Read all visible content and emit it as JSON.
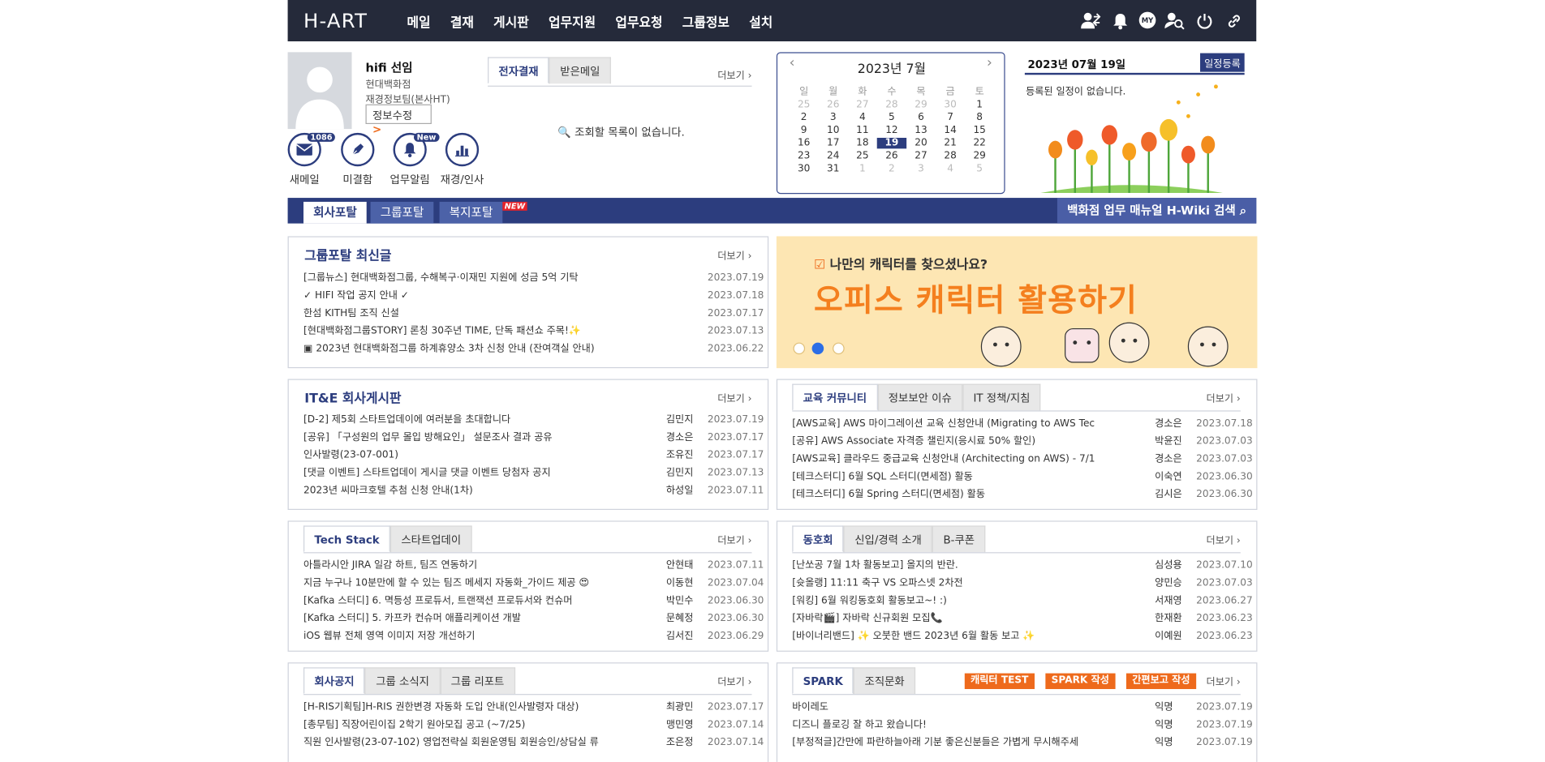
{
  "gnb": {
    "logo": "H-ART",
    "menu": [
      "메일",
      "결재",
      "게시판",
      "업무지원",
      "업무요청",
      "그룹정보",
      "설치"
    ]
  },
  "user": {
    "name": "hifi 선임",
    "company": "현대백화점",
    "dept": "재경정보팀(본사HT)",
    "edit": "정보수정",
    "edit_arrow": ">"
  },
  "quick": [
    {
      "label": "새메일",
      "icon": "mail-icon",
      "badge": "1086"
    },
    {
      "label": "미결함",
      "icon": "pen-icon",
      "badge": ""
    },
    {
      "label": "업무알림",
      "icon": "bell-icon",
      "badge": "New"
    },
    {
      "label": "재경/인사",
      "icon": "chart-icon",
      "badge": ""
    }
  ],
  "approval": {
    "tabs": [
      "전자결재",
      "받은메일"
    ],
    "more": "더보기",
    "empty": "조회할 목록이 없습니다."
  },
  "calendar": {
    "title": "2023년 7월",
    "weekdays": [
      "일",
      "월",
      "화",
      "수",
      "목",
      "금",
      "토"
    ],
    "days": [
      "25",
      "26",
      "27",
      "28",
      "29",
      "30",
      "1",
      "2",
      "3",
      "4",
      "5",
      "6",
      "7",
      "8",
      "9",
      "10",
      "11",
      "12",
      "13",
      "14",
      "15",
      "16",
      "17",
      "18",
      "19",
      "20",
      "21",
      "22",
      "23",
      "24",
      "25",
      "26",
      "27",
      "28",
      "29",
      "30",
      "31",
      "1",
      "2",
      "3",
      "4",
      "5"
    ],
    "today": "19"
  },
  "schedule": {
    "date": "2023년 07월 19일",
    "register": "일정등록",
    "empty": "등록된 일정이 없습니다."
  },
  "portal": {
    "tabs": [
      "회사포탈",
      "그룹포탈",
      "복지포탈"
    ],
    "new": "NEW",
    "search": "백화점 업무 매뉴얼 H-Wiki 검색"
  },
  "group_news": {
    "title": "그룹포탈 최신글",
    "more": "더보기",
    "rows": [
      {
        "s": "[그룹뉴스] 현대백화점그룹, 수해복구·이재민 지원에 성금 5억 기탁",
        "d": "2023.07.19"
      },
      {
        "s": "✓ HIFI 작업 공지 안내 ✓",
        "d": "2023.07.18"
      },
      {
        "s": "한섬 KITH팀 조직 신설",
        "d": "2023.07.17"
      },
      {
        "s": "[현대백화점그룹STORY] 론칭 30주년 TIME, 단독 패션쇼 주목!✨",
        "d": "2023.07.13"
      },
      {
        "s": "▣ 2023년 현대백화점그룹 하계휴양소 3차 신청 안내 (잔여객실 안내)",
        "d": "2023.06.22"
      }
    ]
  },
  "banner": {
    "headline": "나만의 캐릭터를 찾으셨나요?",
    "title": "오피스 캐릭터 활용하기"
  },
  "ite_board": {
    "title": "IT&E 회사게시판",
    "more": "더보기",
    "rows": [
      {
        "s": "[D-2] 제5회 스타트업데이에 여러분을 초대합니다",
        "a": "김민지",
        "d": "2023.07.19"
      },
      {
        "s": "[공유] 「구성원의 업무 몰입 방해요인」 설문조사 결과 공유",
        "a": "경소은",
        "d": "2023.07.17"
      },
      {
        "s": "인사발령(23-07-001)",
        "a": "조유진",
        "d": "2023.07.17"
      },
      {
        "s": "[댓글 이벤트] 스타트업데이 게시글 댓글 이벤트 당첨자 공지",
        "a": "김민지",
        "d": "2023.07.13"
      },
      {
        "s": "2023년 씨마크호텔 추첨 신청 안내(1차)",
        "a": "하성일",
        "d": "2023.07.11"
      }
    ]
  },
  "edu": {
    "tabs": [
      "교육 커뮤니티",
      "정보보안 이슈",
      "IT 정책/지침"
    ],
    "more": "더보기",
    "rows": [
      {
        "s": "[AWS교육] AWS 마이그레이션 교육 신청안내 (Migrating to AWS Tec",
        "a": "경소은",
        "d": "2023.07.18"
      },
      {
        "s": "[공유] AWS Associate 자격증 챌린지(응시료 50% 할인)",
        "a": "박윤진",
        "d": "2023.07.03"
      },
      {
        "s": "[AWS교육] 클라우드 중급교육 신청안내 (Architecting on AWS) - 7/1",
        "a": "경소은",
        "d": "2023.07.03"
      },
      {
        "s": "[테크스터디] 6월 SQL 스터디(면세점) 활동",
        "a": "이숙연",
        "d": "2023.06.30"
      },
      {
        "s": "[테크스터디] 6월 Spring 스터디(면세점) 활동",
        "a": "김시은",
        "d": "2023.06.30"
      }
    ]
  },
  "tech": {
    "tabs": [
      "Tech Stack",
      "스타트업데이"
    ],
    "more": "더보기",
    "rows": [
      {
        "s": "아틀라시안 JIRA 일감 하트, 팀즈 연동하기",
        "a": "안현태",
        "d": "2023.07.11"
      },
      {
        "s": "지금 누구나 10분만에 할 수 있는 팀즈 메세지 자동화_가이드 제공 😍",
        "a": "이동현",
        "d": "2023.07.04"
      },
      {
        "s": "[Kafka 스터디] 6. 멱등성 프로듀서, 트랜잭션 프로듀서와 컨슈머",
        "a": "박민수",
        "d": "2023.06.30"
      },
      {
        "s": "[Kafka 스터디] 5. 카프카 컨슈머 애플리케이션 개발",
        "a": "문혜정",
        "d": "2023.06.30"
      },
      {
        "s": "iOS 웹뷰 전체 영역 이미지 저장 개선하기",
        "a": "김서진",
        "d": "2023.06.29"
      }
    ]
  },
  "club": {
    "tabs": [
      "동호회",
      "신입/경력 소개",
      "B-쿠폰"
    ],
    "more": "더보기",
    "rows": [
      {
        "s": "[난쏘공 7월 1차 활동보고] 올지의 반란.",
        "a": "심성용",
        "d": "2023.07.10"
      },
      {
        "s": "[슛올랭] 11:11 축구 VS 오파스넷 2차전",
        "a": "양민승",
        "d": "2023.07.03"
      },
      {
        "s": "[워킹] 6월 워킹동호회 활동보고~! :)",
        "a": "서재영",
        "d": "2023.06.27"
      },
      {
        "s": "[자바락🎬] 자바락 신규회원 모집📞",
        "a": "한재환",
        "d": "2023.06.23"
      },
      {
        "s": "[바이너리밴드] ✨ 오붓한 밴드 2023년 6월 활동 보고 ✨",
        "a": "이예원",
        "d": "2023.06.23"
      }
    ]
  },
  "notice": {
    "tabs": [
      "회사공지",
      "그룹 소식지",
      "그룹 리포트"
    ],
    "more": "더보기",
    "rows": [
      {
        "s": "[H-RIS기획팀]H-RIS 권한변경 자동화 도입 안내(인사발령자 대상)",
        "a": "최광민",
        "d": "2023.07.17"
      },
      {
        "s": "[총무팀] 직장어린이집 2학기 원아모집 공고 (~7/25)",
        "a": "맹민영",
        "d": "2023.07.14"
      },
      {
        "s": "직원 인사발령(23-07-102) 영업전략실 회원운영팀 회원승인/상담실 류",
        "a": "조은정",
        "d": "2023.07.14"
      }
    ]
  },
  "spark": {
    "tabs": [
      "SPARK",
      "조직문화"
    ],
    "buttons": [
      "캐릭터 TEST",
      "SPARK 작성",
      "간편보고 작성"
    ],
    "more": "더보기",
    "rows": [
      {
        "s": "바이레도",
        "a": "익명",
        "d": "2023.07.19"
      },
      {
        "s": "디즈니 플로깅 잘 하고 왔습니다!",
        "a": "익명",
        "d": "2023.07.19"
      },
      {
        "s": "[부정적글]간만에 파란하늘아래 기분 좋은신분들은 가볍게 무시해주세",
        "a": "익명",
        "d": "2023.07.19"
      }
    ]
  },
  "colors": {
    "navy": "#252a3a",
    "accent": "#2c3d7e",
    "orange": "#ee6a1c",
    "banner": "#fde6b3"
  }
}
